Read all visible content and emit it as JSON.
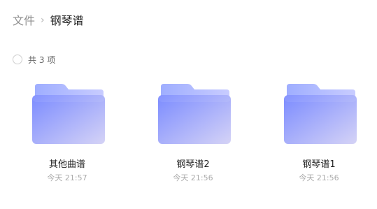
{
  "breadcrumb": {
    "root": "文件",
    "separator": "›",
    "current": "钢琴谱"
  },
  "selection": {
    "count_text": "共 3 项"
  },
  "folders": [
    {
      "name": "其他曲谱",
      "time": "今天 21:57"
    },
    {
      "name": "钢琴谱2",
      "time": "今天 21:56"
    },
    {
      "name": "钢琴谱1",
      "time": "今天 21:56"
    }
  ],
  "icon": {
    "name": "folder-icon",
    "colors": {
      "back": "#a6b2ff",
      "front_start": "#7b8bff",
      "front_end": "#d5d3f6"
    }
  }
}
